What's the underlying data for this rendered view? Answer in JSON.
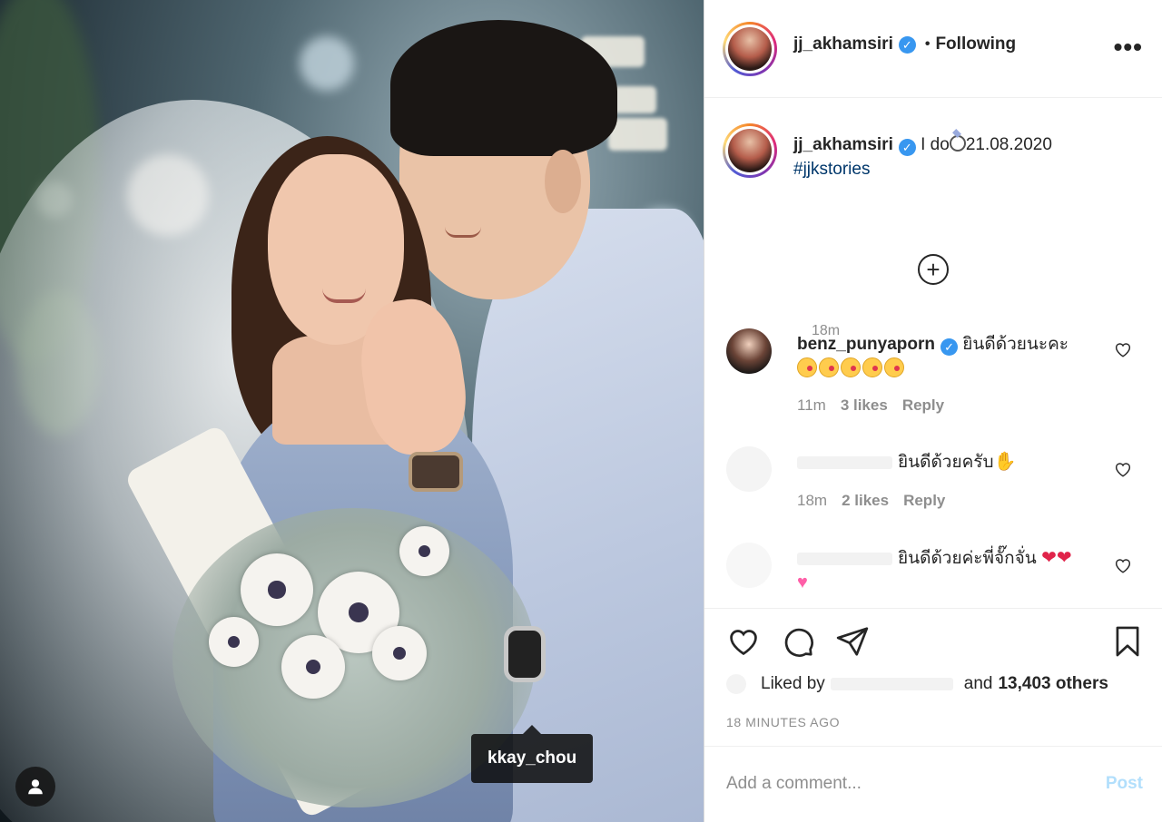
{
  "header": {
    "username": "jj_akhamsiri",
    "follow_state": "Following",
    "separator": "•",
    "more_label": "•••"
  },
  "caption": {
    "username": "jj_akhamsiri",
    "text": "I do",
    "date": "21.08.2020",
    "hashtag": "#jjkstories",
    "time": "18m"
  },
  "load_more_label": "+",
  "comments": [
    {
      "username": "benz_punyaporn",
      "text": "ยินดีด้วยนะคะ",
      "time": "11m",
      "likes": "3 likes",
      "reply": "Reply"
    },
    {
      "username": "",
      "text": "ยินดีด้วยครับ",
      "time": "18m",
      "likes": "2 likes",
      "reply": "Reply"
    },
    {
      "username": "",
      "text": "ยินดีด้วยค่ะพี่จั๊กจั่น"
    }
  ],
  "likes": {
    "prefix": "Liked by",
    "and": "and",
    "count": "13,403 others"
  },
  "timestamp": "18 MINUTES AGO",
  "comment_box": {
    "placeholder": "Add a comment...",
    "post_label": "Post"
  },
  "photo": {
    "tag_label": "kkay_chou"
  },
  "colors": {
    "verified": "#3897f0",
    "hashtag": "#00376b",
    "post_disabled": "#b2dffc",
    "muted": "#8e8e8e"
  }
}
